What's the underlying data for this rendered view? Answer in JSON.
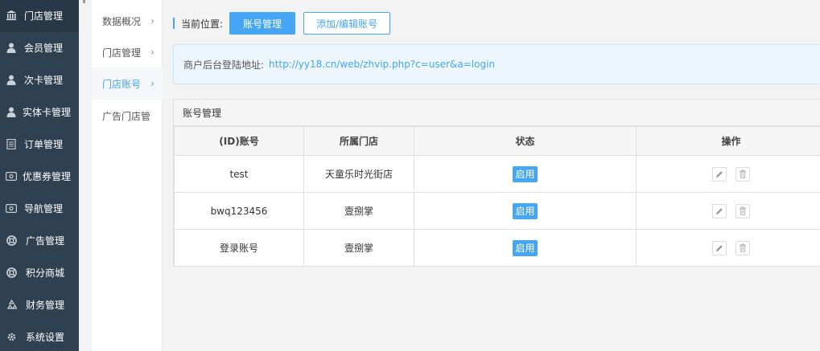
{
  "sidebar": {
    "items": [
      {
        "label": "门店管理",
        "icon": "bank-icon",
        "active": true
      },
      {
        "label": "会员管理",
        "icon": "user-icon"
      },
      {
        "label": "次卡管理",
        "icon": "user-icon"
      },
      {
        "label": "实体卡管理",
        "icon": "user-icon"
      },
      {
        "label": "订单管理",
        "icon": "document-icon"
      },
      {
        "label": "优惠券管理",
        "icon": "ticket-icon"
      },
      {
        "label": "导航管理",
        "icon": "ticket-icon"
      },
      {
        "label": "广告管理",
        "icon": "lifebuoy-icon"
      },
      {
        "label": "积分商城",
        "icon": "lifebuoy-icon"
      },
      {
        "label": "财务管理",
        "icon": "recycle-icon"
      },
      {
        "label": "系统设置",
        "icon": "gear-icon"
      }
    ]
  },
  "submenu": {
    "items": [
      {
        "label": "数据概况"
      },
      {
        "label": "门店管理"
      },
      {
        "label": "门店账号",
        "active": true
      },
      {
        "label": "广告门店管"
      }
    ]
  },
  "breadcrumb": {
    "label": "当前位置:",
    "current": "账号管理",
    "secondary": "添加/编辑账号"
  },
  "info": {
    "label": "商户后台登陆地址:",
    "url": "http://yy18.cn/web/zhvip.php?c=user&a=login"
  },
  "panel": {
    "title": "账号管理",
    "columns": [
      "(ID)账号",
      "所属门店",
      "状态",
      "操作"
    ],
    "rows": [
      {
        "account": "test",
        "store": "天童乐时光街店",
        "status": "启用"
      },
      {
        "account": "bwq123456",
        "store": "壹捌掌",
        "status": "启用"
      },
      {
        "account": "登录账号",
        "store": "壹捌掌",
        "status": "启用"
      }
    ]
  },
  "colors": {
    "sidebar_bg": "#2f4050",
    "accent": "#44a6f5"
  }
}
